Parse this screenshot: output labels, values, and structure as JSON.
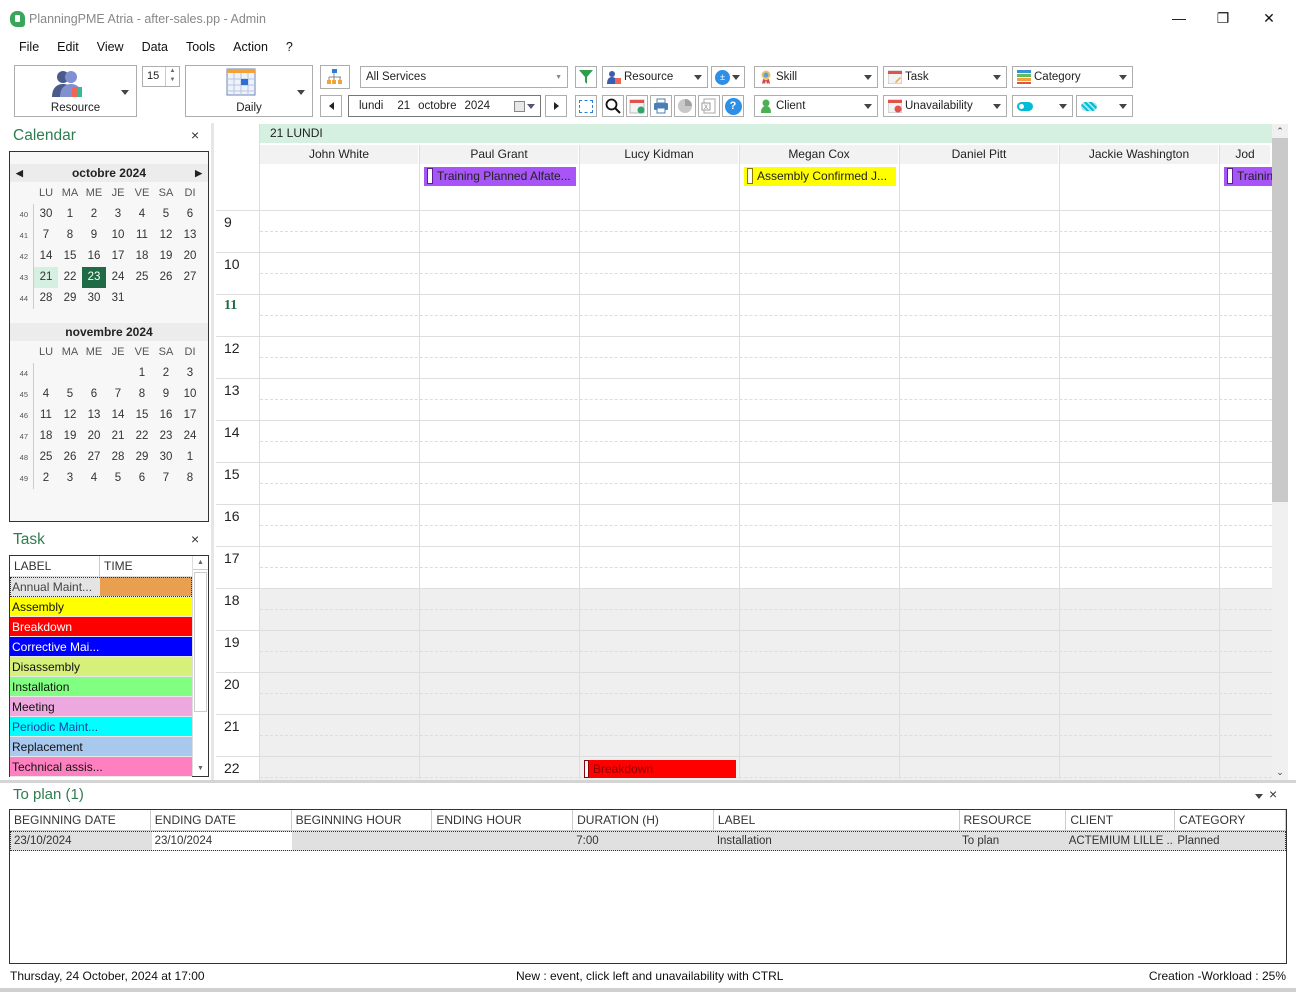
{
  "window": {
    "title": "PlanningPME Atria - after-sales.pp - Admin",
    "minimize": "—",
    "restore": "❐",
    "close": "✕"
  },
  "menu": [
    "File",
    "Edit",
    "View",
    "Data",
    "Tools",
    "Action",
    "?"
  ],
  "toolbar": {
    "resource_label": "Resource",
    "spin_value": "15",
    "view_label": "Daily",
    "services_value": "All Services",
    "date": {
      "weekday": "lundi",
      "day": "21",
      "month": "octobre",
      "year": "2024"
    },
    "filters": {
      "resource": "Resource",
      "skill": "Skill",
      "task": "Task",
      "category": "Category",
      "client": "Client",
      "unavailability": "Unavailability"
    }
  },
  "calendar_panel": {
    "title": "Calendar",
    "close": "×",
    "dow": [
      "LU",
      "MA",
      "ME",
      "JE",
      "VE",
      "SA",
      "DI"
    ],
    "months": [
      {
        "title": "octobre 2024",
        "weeks": [
          {
            "wk": "40",
            "days": [
              "30",
              "1",
              "2",
              "3",
              "4",
              "5",
              "6"
            ]
          },
          {
            "wk": "41",
            "days": [
              "7",
              "8",
              "9",
              "10",
              "11",
              "12",
              "13"
            ]
          },
          {
            "wk": "42",
            "days": [
              "14",
              "15",
              "16",
              "17",
              "18",
              "19",
              "20"
            ]
          },
          {
            "wk": "43",
            "days": [
              "21",
              "22",
              "23",
              "24",
              "25",
              "26",
              "27"
            ]
          },
          {
            "wk": "44",
            "days": [
              "28",
              "29",
              "30",
              "31",
              "",
              "",
              ""
            ]
          }
        ]
      },
      {
        "title": "novembre 2024",
        "weeks": [
          {
            "wk": "44",
            "days": [
              "",
              "",
              "",
              "",
              "1",
              "2",
              "3"
            ]
          },
          {
            "wk": "45",
            "days": [
              "4",
              "5",
              "6",
              "7",
              "8",
              "9",
              "10"
            ]
          },
          {
            "wk": "46",
            "days": [
              "11",
              "12",
              "13",
              "14",
              "15",
              "16",
              "17"
            ]
          },
          {
            "wk": "47",
            "days": [
              "18",
              "19",
              "20",
              "21",
              "22",
              "23",
              "24"
            ]
          },
          {
            "wk": "48",
            "days": [
              "25",
              "26",
              "27",
              "28",
              "29",
              "30",
              "1"
            ]
          },
          {
            "wk": "49",
            "days": [
              "2",
              "3",
              "4",
              "5",
              "6",
              "7",
              "8"
            ]
          }
        ]
      }
    ],
    "selected_day": "21",
    "today": "23"
  },
  "task_panel": {
    "title": "Task",
    "close": "×",
    "columns": [
      "LABEL",
      "TIME"
    ],
    "items": [
      {
        "label": "Annual Maint...",
        "color": "#e8a050",
        "text": "#444"
      },
      {
        "label": "Assembly",
        "color": "#ffff00",
        "text": "#111"
      },
      {
        "label": "Breakdown",
        "color": "#ff0000",
        "text": "#fff"
      },
      {
        "label": "Corrective Mai...",
        "color": "#0000ff",
        "text": "#fff"
      },
      {
        "label": "Disassembly",
        "color": "#d6f07a",
        "text": "#111"
      },
      {
        "label": "Installation",
        "color": "#80ff80",
        "text": "#111"
      },
      {
        "label": "Meeting",
        "color": "#eea8e0",
        "text": "#111"
      },
      {
        "label": "Periodic Maint...",
        "color": "#00ffff",
        "text": "#1a3ca8"
      },
      {
        "label": "Replacement",
        "color": "#a8c8ee",
        "text": "#111"
      },
      {
        "label": "Technical assis...",
        "color": "#ff80c0",
        "text": "#111"
      }
    ]
  },
  "planner": {
    "day_header": "21 LUNDI",
    "resources": [
      "John White",
      "Paul Grant",
      "Lucy Kidman",
      "Megan Cox",
      "Daniel Pitt",
      "Jackie Washington",
      "Jod"
    ],
    "hours": [
      "9",
      "10",
      "11",
      "12",
      "13",
      "14",
      "15",
      "16",
      "17",
      "18",
      "19",
      "20",
      "21",
      "22"
    ],
    "current_hour": "11",
    "events": [
      {
        "label": "Training Planned Alfate...",
        "resource_index": 1,
        "color": "#a855f7",
        "mark": "#5b1d9a",
        "text": "#222",
        "slot": "all-day"
      },
      {
        "label": "Assembly Confirmed J...",
        "resource_index": 3,
        "color": "#ffff00",
        "mark": "#8a7a00",
        "text": "#222",
        "slot": "all-day"
      },
      {
        "label": "Training",
        "resource_index": 6,
        "color": "#a855f7",
        "mark": "#5b1d9a",
        "text": "#222",
        "slot": "all-day"
      },
      {
        "label": "Breakdown",
        "resource_index": 2,
        "color": "#ff0000",
        "mark": "#8b0000",
        "text": "#8b0000",
        "slot": "22:00"
      }
    ]
  },
  "to_plan": {
    "title": "To plan (1)",
    "columns": [
      "BEGINNING DATE",
      "ENDING DATE",
      "BEGINNING HOUR",
      "ENDING HOUR",
      "DURATION (H)",
      "LABEL",
      "RESOURCE",
      "CLIENT",
      "CATEGORY"
    ],
    "rows": [
      [
        "23/10/2024",
        "23/10/2024",
        "",
        "",
        "7:00",
        "Installation",
        "To plan",
        "ACTEMIUM LILLE ...",
        "Planned"
      ]
    ]
  },
  "status_bar": {
    "left": "Thursday, 24 October, 2024 at 17:00",
    "center": "New : event, click left and unavailability with CTRL",
    "right": "Creation -Workload : 25%"
  }
}
